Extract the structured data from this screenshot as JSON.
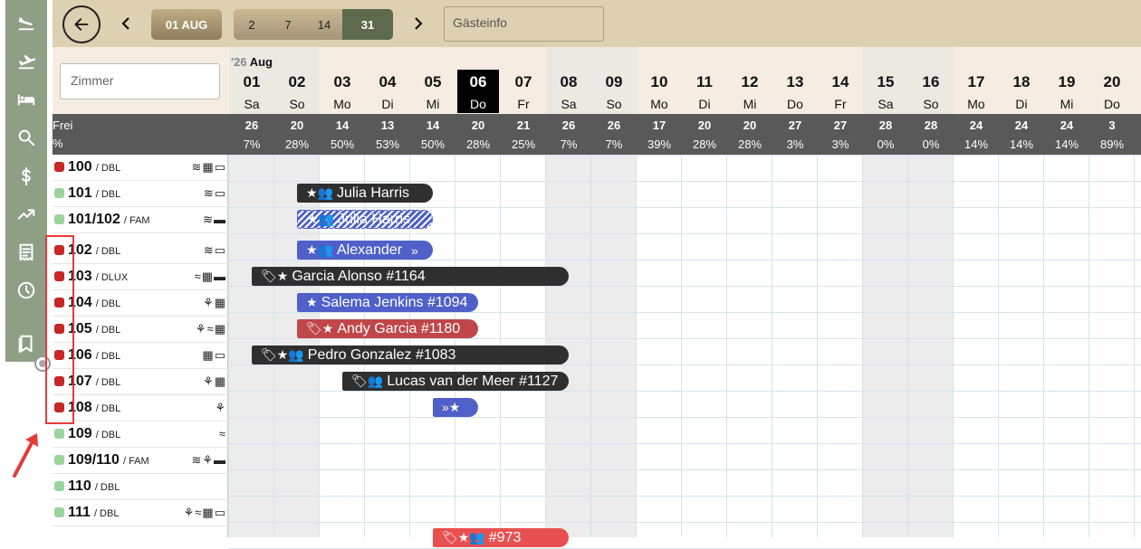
{
  "sidebar": {
    "items": [
      {
        "icon": "plane-landing-icon"
      },
      {
        "icon": "plane-takeoff-icon"
      },
      {
        "icon": "bed-icon"
      },
      {
        "icon": "search-icon"
      },
      {
        "icon": "dollar-icon"
      },
      {
        "icon": "trending-up-icon"
      },
      {
        "icon": "invoice-icon"
      },
      {
        "icon": "clock-icon"
      },
      {
        "icon": "bookmark-icon"
      }
    ]
  },
  "toolbar": {
    "date_label": "01 AUG",
    "range_options": [
      "2",
      "7",
      "14",
      "31"
    ],
    "active_range": "31",
    "guest_info_placeholder": "Gästeinfo"
  },
  "calendar": {
    "room_search_placeholder": "Zimmer",
    "month_year": "'26",
    "month_name": "Aug",
    "free_label": "Frei",
    "pct_label": "%",
    "days": [
      {
        "num": "01",
        "dow": "Sa",
        "free": "26",
        "pct": "7%"
      },
      {
        "num": "02",
        "dow": "So",
        "free": "20",
        "pct": "28%"
      },
      {
        "num": "03",
        "dow": "Mo",
        "free": "14",
        "pct": "50%"
      },
      {
        "num": "04",
        "dow": "Di",
        "free": "13",
        "pct": "53%"
      },
      {
        "num": "05",
        "dow": "Mi",
        "free": "14",
        "pct": "50%"
      },
      {
        "num": "06",
        "dow": "Do",
        "free": "20",
        "pct": "28%"
      },
      {
        "num": "07",
        "dow": "Fr",
        "free": "21",
        "pct": "25%"
      },
      {
        "num": "08",
        "dow": "Sa",
        "free": "26",
        "pct": "7%"
      },
      {
        "num": "09",
        "dow": "So",
        "free": "26",
        "pct": "7%"
      },
      {
        "num": "10",
        "dow": "Mo",
        "free": "17",
        "pct": "39%"
      },
      {
        "num": "11",
        "dow": "Di",
        "free": "20",
        "pct": "28%"
      },
      {
        "num": "12",
        "dow": "Mi",
        "free": "20",
        "pct": "28%"
      },
      {
        "num": "13",
        "dow": "Do",
        "free": "27",
        "pct": "3%"
      },
      {
        "num": "14",
        "dow": "Fr",
        "free": "27",
        "pct": "3%"
      },
      {
        "num": "15",
        "dow": "Sa",
        "free": "28",
        "pct": "0%"
      },
      {
        "num": "16",
        "dow": "So",
        "free": "28",
        "pct": "0%"
      },
      {
        "num": "17",
        "dow": "Mo",
        "free": "24",
        "pct": "14%"
      },
      {
        "num": "18",
        "dow": "Di",
        "free": "24",
        "pct": "14%"
      },
      {
        "num": "19",
        "dow": "Mi",
        "free": "24",
        "pct": "14%"
      },
      {
        "num": "20",
        "dow": "Do",
        "free": "3",
        "pct": "89%"
      }
    ],
    "today_index": 5
  },
  "rooms": [
    {
      "num": "100",
      "type": "/ DBL",
      "status": "occupied",
      "icons": "≋▦▭"
    },
    {
      "num": "101",
      "type": "/ DBL",
      "status": "free",
      "icons": "≋▭"
    },
    {
      "num": "101/102",
      "type": "/ FAM",
      "status": "free",
      "icons": "≋▬"
    },
    {
      "num": "102",
      "type": "/ DBL",
      "status": "occupied",
      "icons": "≋▭"
    },
    {
      "num": "103",
      "type": "/ DLUX",
      "status": "occupied",
      "icons": "≈▦▬"
    },
    {
      "num": "104",
      "type": "/ DBL",
      "status": "occupied",
      "icons": "⚘▦"
    },
    {
      "num": "105",
      "type": "/ DBL",
      "status": "occupied",
      "icons": "⚘≈▦"
    },
    {
      "num": "106",
      "type": "/ DBL",
      "status": "occupied",
      "icons": "▦▭"
    },
    {
      "num": "107",
      "type": "/ DBL",
      "status": "occupied",
      "icons": "⚘▦"
    },
    {
      "num": "108",
      "type": "/ DBL",
      "status": "occupied",
      "icons": "⚘"
    },
    {
      "num": "109",
      "type": "/ DBL",
      "status": "free",
      "icons": "≈"
    },
    {
      "num": "109/110",
      "type": "/ FAM",
      "status": "free",
      "icons": "≋⚘▬"
    },
    {
      "num": "110",
      "type": "/ DBL",
      "status": "free",
      "icons": ""
    },
    {
      "num": "111",
      "type": "/ DBL",
      "status": "free",
      "icons": "⚘≈▦▭"
    }
  ],
  "bookings": [
    {
      "label": "Julia Harris",
      "symbols": "★👥",
      "style": "dark"
    },
    {
      "label": "Julia Harris",
      "symbols": "★👥",
      "style": "stripe"
    },
    {
      "label": "Alexander",
      "symbols": "★👥",
      "suffix": "»",
      "style": "blue"
    },
    {
      "label": "Garcia Alonso #1164",
      "symbols": "🏷★",
      "style": "dark"
    },
    {
      "label": "Salema Jenkins #1094",
      "symbols": "★",
      "style": "blue"
    },
    {
      "label": "Andy Garcia #1180",
      "symbols": "🏷★",
      "style": "red"
    },
    {
      "label": "Pedro Gonzalez #1083",
      "symbols": "🏷★👥",
      "style": "dark"
    },
    {
      "label": "Lucas van der Meer #1127",
      "symbols": "🏷👥",
      "style": "dark"
    },
    {
      "label": "",
      "symbols": "»★",
      "style": "blue"
    },
    {
      "label": "#973",
      "symbols": "🏷★👥",
      "style": "pink"
    }
  ],
  "colors": {
    "sidebar": "#8f9f86",
    "topbar": "#ded1b2",
    "header": "#f5ede1",
    "stats_bar": "#595959",
    "status_occupied": "#c62828",
    "status_free": "#9bd39c",
    "booking_dark": "#2f2f2f",
    "booking_blue": "#4f60c8",
    "booking_red": "#c0464a",
    "highlight": "#e53a3a"
  }
}
